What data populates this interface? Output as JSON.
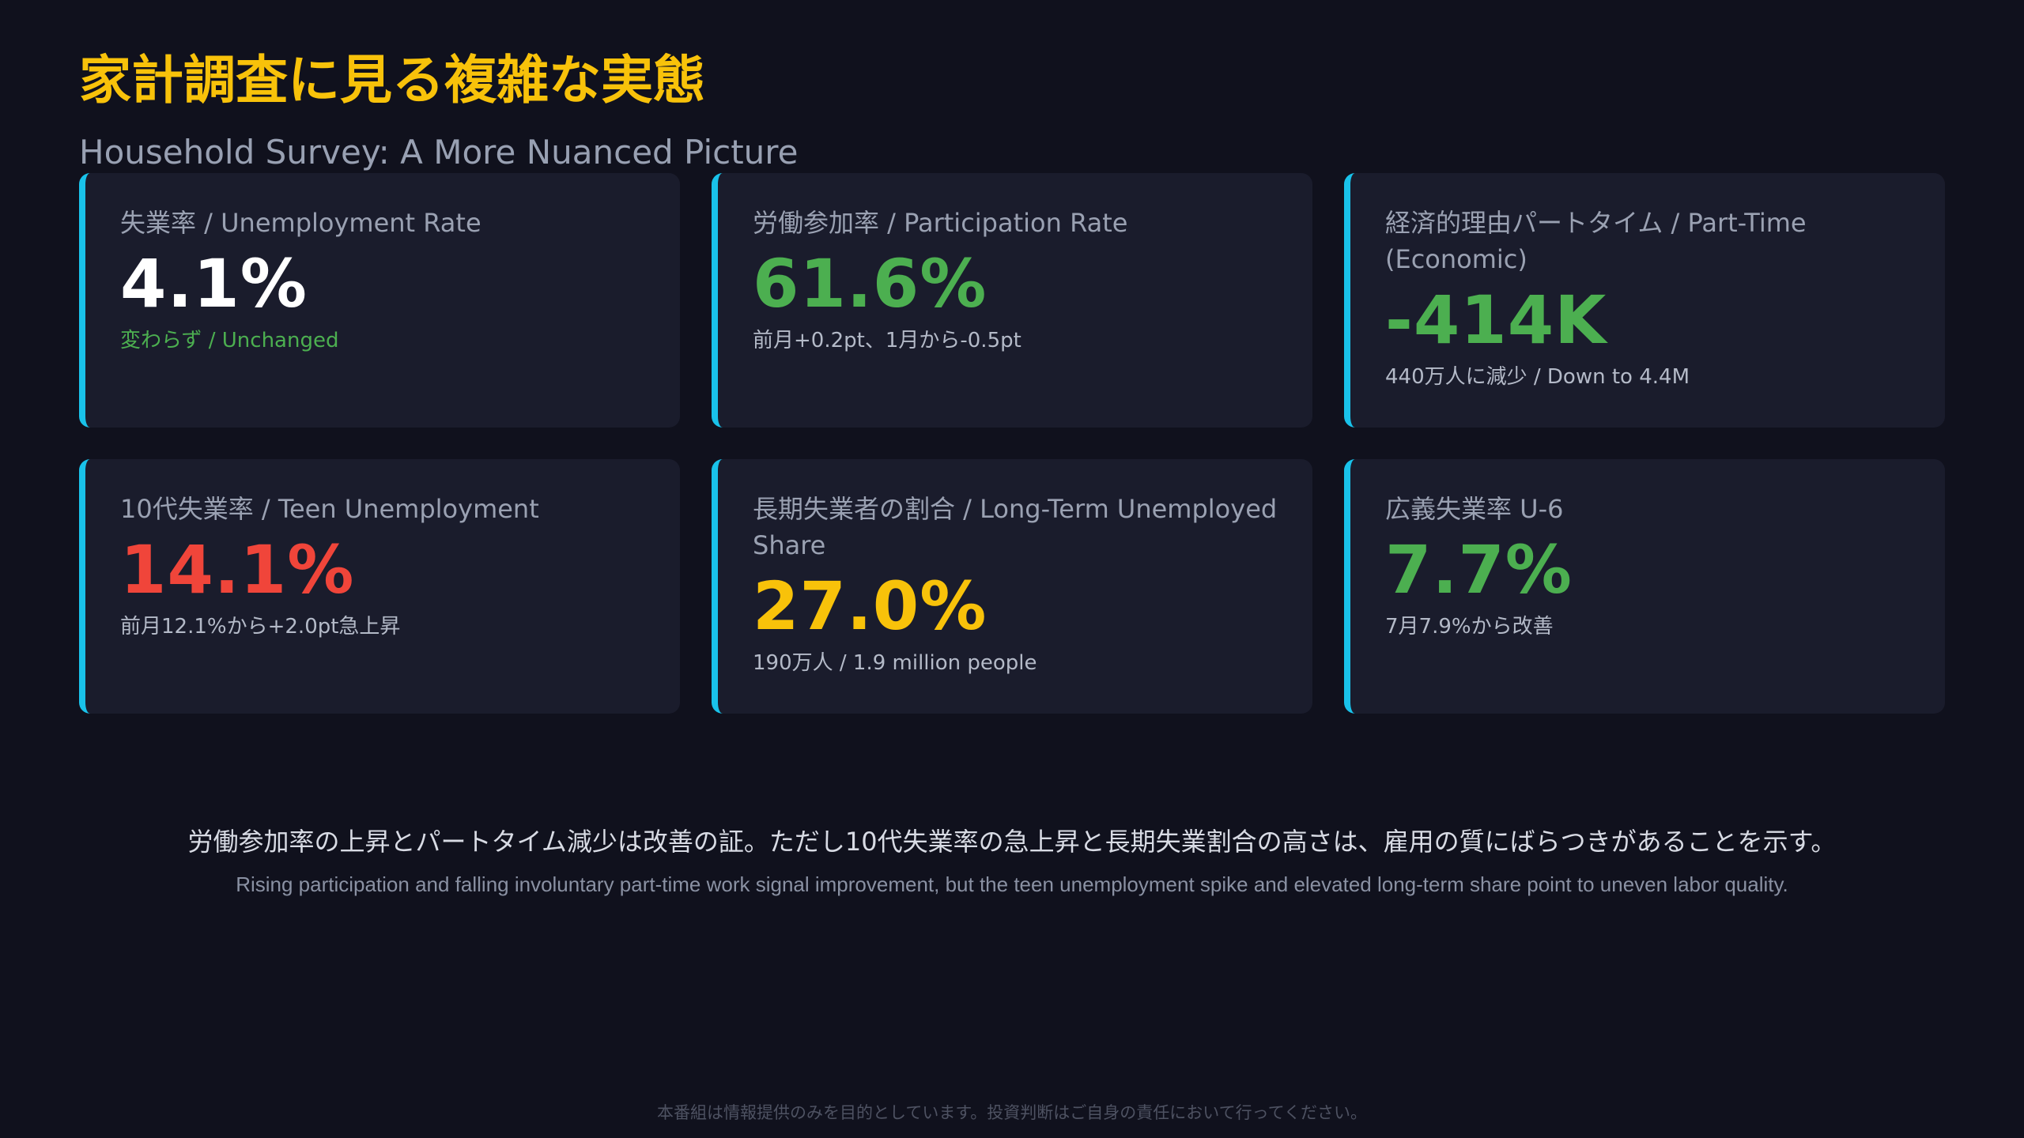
{
  "header": {
    "title_ja": "家計調査に見る複雑な実態",
    "title_en": "Household Survey: A More Nuanced Picture"
  },
  "colors": {
    "title": "#f8c20a",
    "accent_border": "#19c2ea",
    "card_bg": "#1a1c2c",
    "page_bg": "#10111d",
    "white": "#ffffff",
    "green": "#4caf50",
    "red": "#f0453a",
    "yellow": "#f8c20a"
  },
  "cards": [
    {
      "label": "失業率 / Unemployment Rate",
      "value": "4.1%",
      "value_color": "#ffffff",
      "note": "変わらず / Unchanged",
      "note_color": "#4caf50"
    },
    {
      "label": "労働参加率 / Participation Rate",
      "value": "61.6%",
      "value_color": "#4caf50",
      "note": "前月+0.2pt、1月から-0.5pt",
      "note_color": "#b4bac8"
    },
    {
      "label": "経済的理由パートタイム / Part-Time (Economic)",
      "value": "-414K",
      "value_color": "#4caf50",
      "note": "440万人に減少 / Down to 4.4M",
      "note_color": "#b4bac8"
    },
    {
      "label": "10代失業率 / Teen Unemployment",
      "value": "14.1%",
      "value_color": "#f0453a",
      "note": "前月12.1%から+2.0pt急上昇",
      "note_color": "#b4bac8"
    },
    {
      "label": "長期失業者の割合 / Long-Term Unemployed Share",
      "value": "27.0%",
      "value_color": "#f8c20a",
      "note": "190万人 / 1.9 million people",
      "note_color": "#b4bac8"
    },
    {
      "label": "広義失業率 U-6",
      "value": "7.7%",
      "value_color": "#4caf50",
      "note": "7月7.9%から改善",
      "note_color": "#b4bac8"
    }
  ],
  "summary": {
    "ja": "労働参加率の上昇とパートタイム減少は改善の証。ただし10代失業率の急上昇と長期失業割合の高さは、雇用の質にばらつきがあることを示す。",
    "en": "Rising participation and falling involuntary part-time work signal improvement, but the teen unemployment spike and elevated long-term share point to uneven labor quality."
  },
  "footer": {
    "disclaimer": "本番組は情報提供のみを目的としています。投資判断はご自身の責任において行ってください。"
  }
}
